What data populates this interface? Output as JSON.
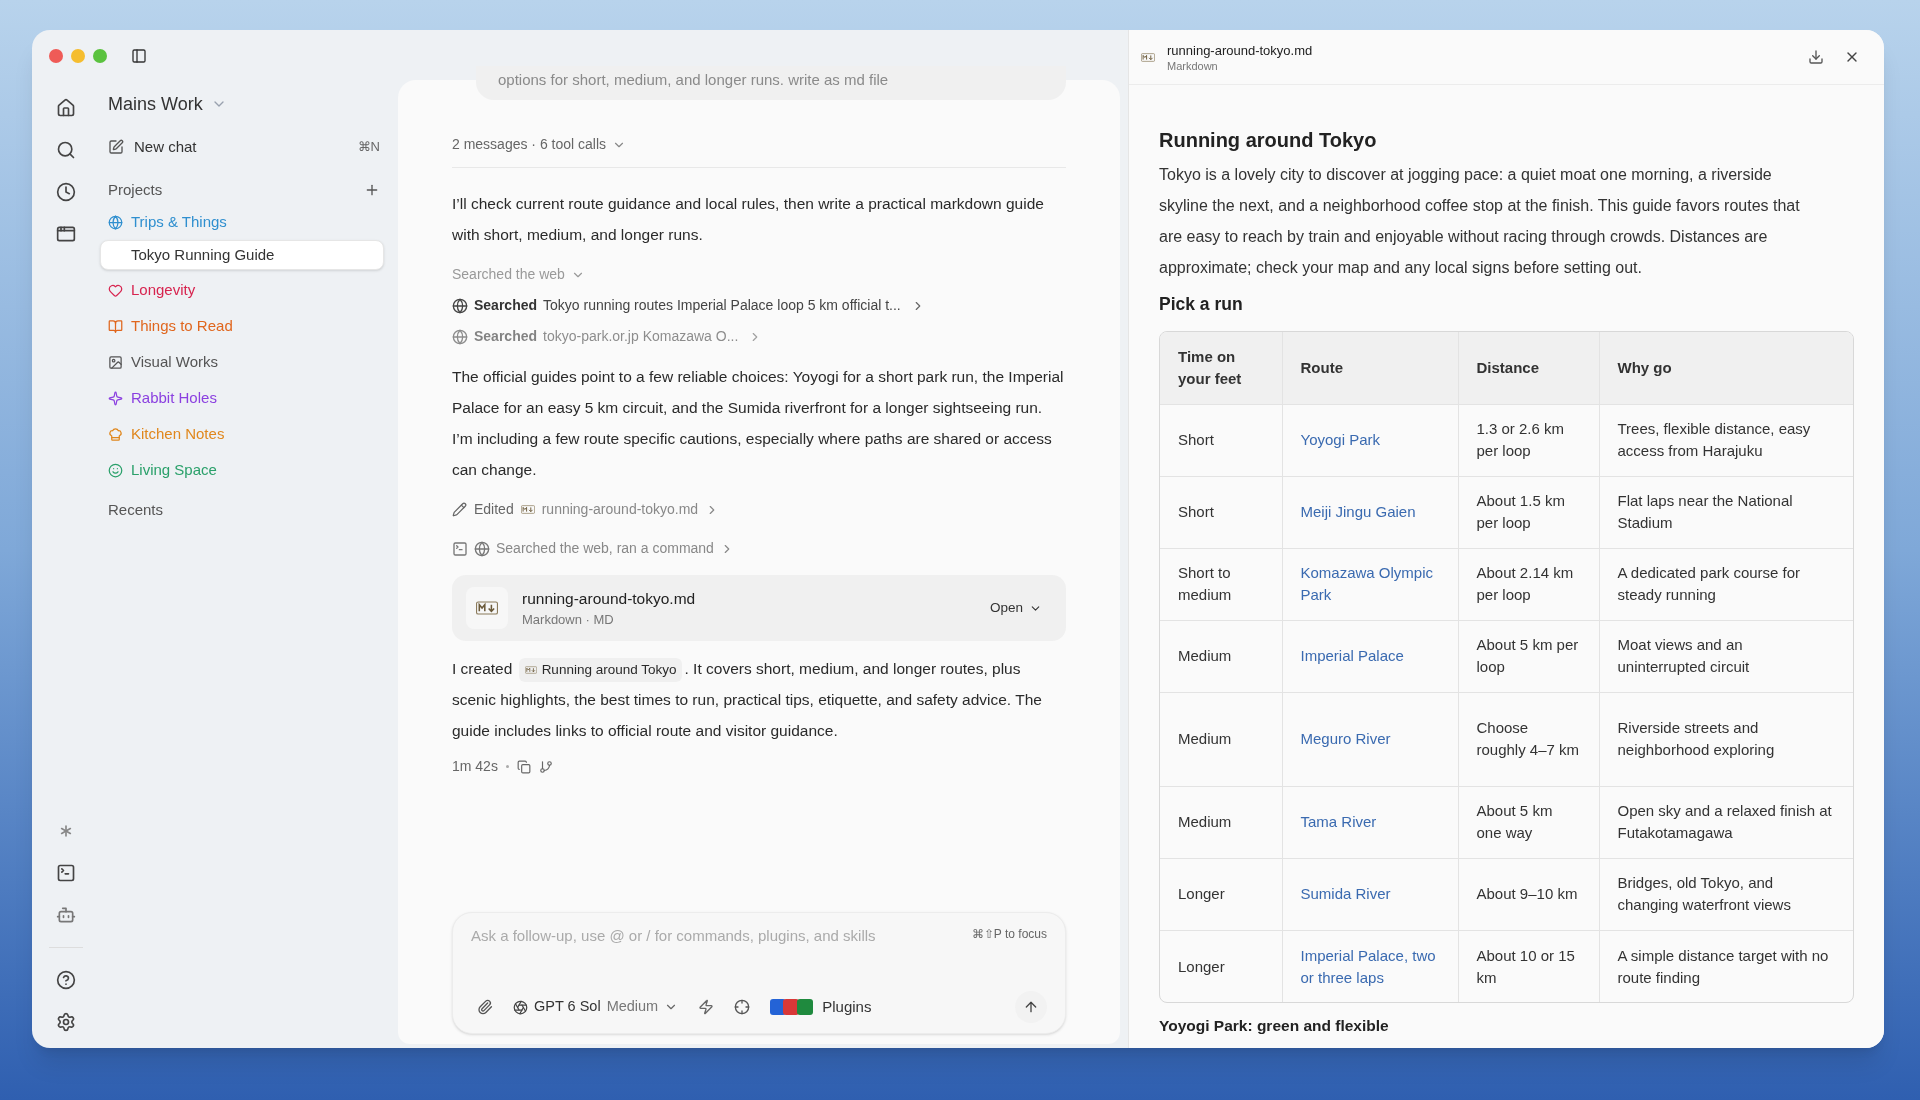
{
  "sidebar": {
    "workspace": "Mains Work",
    "new_chat": {
      "label": "New chat",
      "shortcut": "⌘N"
    },
    "projects_label": "Projects",
    "projects": [
      {
        "label": "Trips & Things",
        "color": "#2f8fcf",
        "selected": false,
        "children": [
          {
            "label": "Tokyo Running Guide",
            "selected": true
          }
        ]
      },
      {
        "label": "Longevity",
        "color": "#d7244f",
        "selected": false
      },
      {
        "label": "Things to Read",
        "color": "#e0661d",
        "selected": false
      },
      {
        "label": "Visual Works",
        "color": "#545454",
        "selected": false
      },
      {
        "label": "Rabbit Holes",
        "color": "#8b40e0",
        "selected": false
      },
      {
        "label": "Kitchen Notes",
        "color": "#e0871c",
        "selected": false
      },
      {
        "label": "Living Space",
        "color": "#2aa06a",
        "selected": false
      }
    ],
    "recents_label": "Recents"
  },
  "chat": {
    "previous_prompt": "options for short, medium, and longer runs. write as md file",
    "summary": "2 messages · 6 tool calls",
    "intro": "I’ll check current route guidance and local rules, then write a practical markdown guide with short, medium, and longer runs.",
    "search_group": {
      "label": "Searched the web",
      "expanded": true,
      "searches": [
        {
          "verb": "Searched",
          "query": "Tokyo running routes Imperial Palace loop 5 km official t...",
          "dimmed": false
        },
        {
          "verb": "Searched",
          "query": "tokyo-park.or.jp Komazawa O...",
          "dimmed": true
        }
      ]
    },
    "answer": "The official guides point to a few reliable choices: Yoyogi for a short park run, the Imperial Palace for an easy 5 km circuit, and the Sumida riverfront for a longer sightseeing run. I’m including a few route specific cautions, especially where paths are shared or access can change.",
    "edit": {
      "verb": "Edited",
      "file": "running-around-tokyo.md"
    },
    "activity": "Searched the web, ran a command",
    "file_card": {
      "name": "running-around-tokyo.md",
      "meta": "Markdown · MD",
      "action": "Open"
    },
    "closing": {
      "before": "I created",
      "chip": "Running around Tokyo",
      "after": ". It covers short, medium, and longer routes, plus scenic highlights, the best times to run, practical tips, etiquette, and safety advice. The guide includes links to official route and visitor guidance."
    },
    "duration": "1m 42s"
  },
  "composer": {
    "placeholder": "Ask a follow-up, use @ or / for commands, plugins, and skills",
    "shortcut": "⌘⇧P to focus",
    "model": "GPT 6 Sol",
    "effort": "Medium",
    "plugins": "Plugins"
  },
  "document": {
    "filename": "running-around-tokyo.md",
    "filetype": "Markdown",
    "title": "Running around Tokyo",
    "intro": "Tokyo is a lovely city to discover at jogging pace: a quiet moat one morning, a riverside skyline the next, and a neighborhood coffee stop at the finish. This guide favors routes that are easy to reach by train and enjoyable without racing through crowds. Distances are approximate; check your map and any local signs before setting out.",
    "section": "Pick a run",
    "table": {
      "columns": [
        "Time on your feet",
        "Route",
        "Distance",
        "Why go"
      ],
      "rows": [
        [
          "Short",
          "Yoyogi Park",
          "1.3 or 2.6 km per loop",
          "Trees, flexible distance, easy access from Harajuku"
        ],
        [
          "Short",
          "Meiji Jingu Gaien",
          "About 1.5 km per loop",
          "Flat laps near the National Stadium"
        ],
        [
          "Short to medium",
          "Komazawa Olympic Park",
          "About 2.14 km per loop",
          "A dedicated park course for steady running"
        ],
        [
          "Medium",
          "Imperial Palace",
          "About 5 km per loop",
          "Moat views and an uninterrupted circuit"
        ],
        [
          "Medium",
          "Meguro River",
          "Choose roughly 4–7 km",
          "Riverside streets and neighborhood exploring"
        ],
        [
          "Medium",
          "Tama River",
          "About 5 km one way",
          "Open sky and a relaxed finish at Futakotamagawa"
        ],
        [
          "Longer",
          "Sumida River",
          "About 9–10 km",
          "Bridges, old Tokyo, and changing waterfront views"
        ],
        [
          "Longer",
          "Imperial Palace, two or three laps",
          "About 10 or 15 km",
          "A simple distance target with no route finding"
        ]
      ]
    },
    "next_heading": "Yoyogi Park: green and flexible"
  }
}
